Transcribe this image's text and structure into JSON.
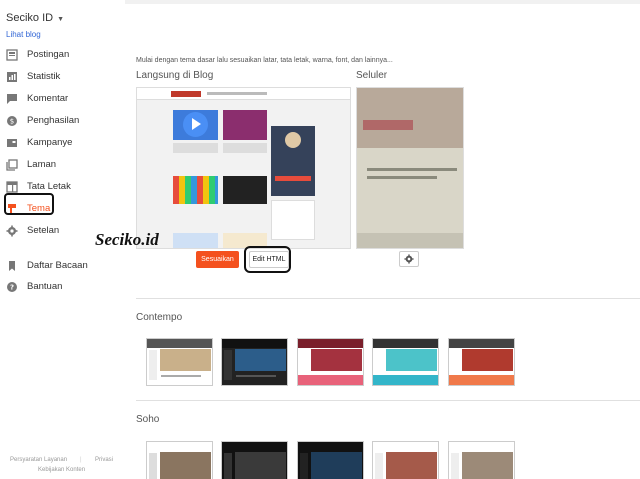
{
  "sidebar": {
    "blog_title": "Seciko ID",
    "view_blog": "Lihat blog",
    "items": [
      {
        "label": "Postingan",
        "icon": "posts-icon"
      },
      {
        "label": "Statistik",
        "icon": "stats-icon"
      },
      {
        "label": "Komentar",
        "icon": "comments-icon"
      },
      {
        "label": "Penghasilan",
        "icon": "earnings-icon"
      },
      {
        "label": "Kampanye",
        "icon": "campaign-icon"
      },
      {
        "label": "Laman",
        "icon": "pages-icon"
      },
      {
        "label": "Tata Letak",
        "icon": "layout-icon"
      },
      {
        "label": "Tema",
        "icon": "theme-icon"
      },
      {
        "label": "Setelan",
        "icon": "settings-icon"
      }
    ],
    "secondary": [
      {
        "label": "Daftar Bacaan",
        "icon": "bookmark-icon"
      },
      {
        "label": "Bantuan",
        "icon": "help-icon"
      }
    ],
    "footer": {
      "terms": "Persyaratan Layanan",
      "privacy": "Privasi",
      "content_policy": "Kebijakan Konten"
    }
  },
  "main": {
    "intro": "Mulai dengan tema dasar lalu sesuaikan latar, tata letak, warna, font, dan lainnya...",
    "live_label": "Langsung di Blog",
    "mobile_label": "Seluler",
    "customize_button": "Sesuaikan",
    "edit_html_button": "Edit HTML",
    "watermark": "Seciko.id",
    "groups": [
      {
        "title": "Contempo",
        "themes": 5
      },
      {
        "title": "Soho",
        "themes": 5
      }
    ]
  },
  "colors": {
    "accent": "#f4511e",
    "link": "#3367d6"
  }
}
